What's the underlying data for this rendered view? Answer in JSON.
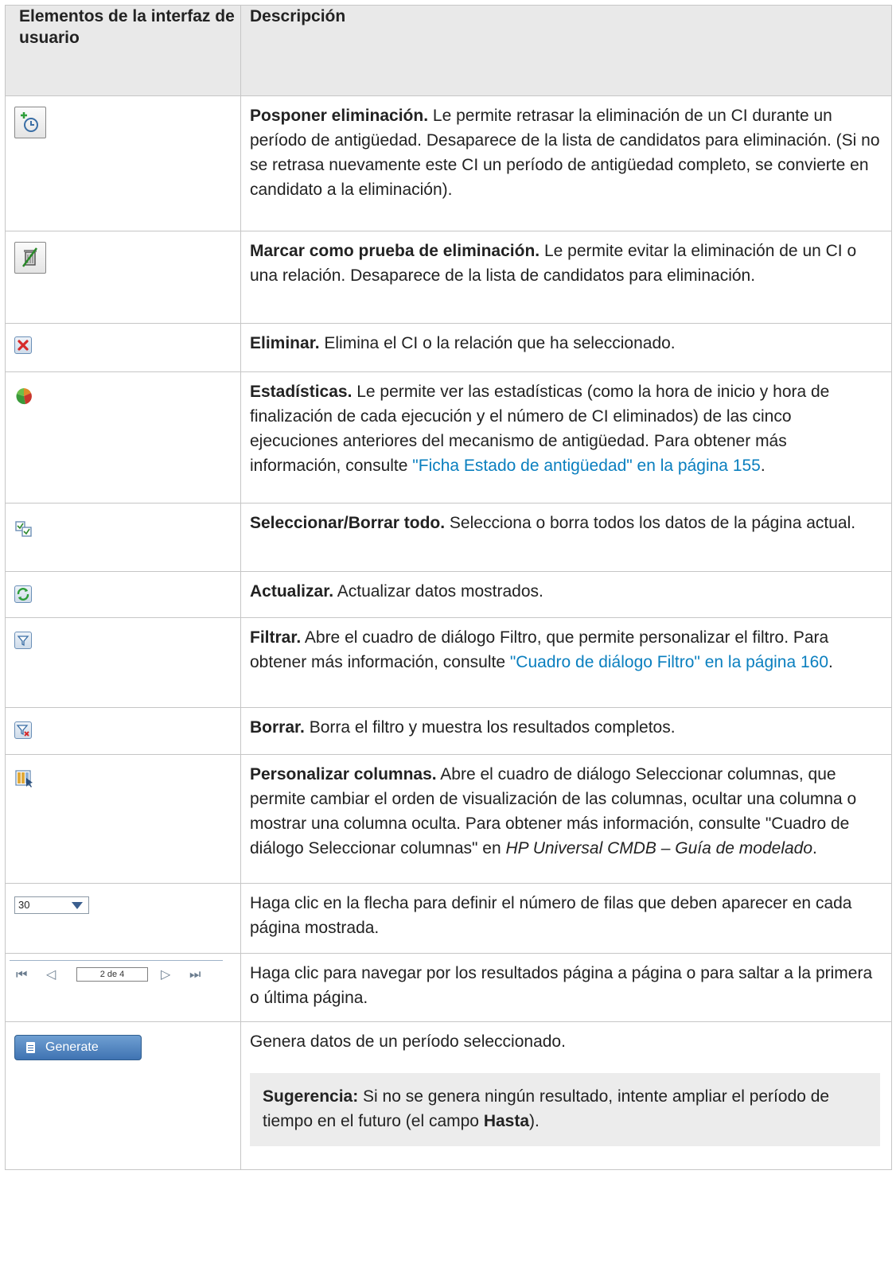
{
  "header": {
    "col1": "Elementos de la interfaz de usuario",
    "col2": "Descripción"
  },
  "rows": [
    {
      "icon": "postpone-deletion-icon",
      "title": "Posponer eliminación.",
      "text": " Le permite retrasar la eliminación de un CI durante un período de antigüedad. Desaparece de la lista de candidatos para eliminación. (Si no se retrasa nuevamente este CI un período de antigüedad completo, se convierte en candidato a la eliminación)."
    },
    {
      "icon": "deletion-proof-icon",
      "title": "Marcar como prueba de eliminación.",
      "text": " Le permite evitar la eliminación de un CI o una relación. Desaparece de la lista de candidatos para eliminación."
    },
    {
      "icon": "delete-icon",
      "title": "Eliminar.",
      "text": " Elimina el CI o la relación que ha seleccionado."
    },
    {
      "icon": "statistics-pie-icon",
      "title": "Estadísticas.",
      "text": " Le permite ver las estadísticas (como la hora de inicio y hora de finalización de cada ejecución y el número de CI eliminados) de las cinco ejecuciones anteriores del mecanismo de antigüedad. Para obtener más información, consulte ",
      "link": "\"Ficha Estado de antigüedad\" en la página 155",
      "after": "."
    },
    {
      "icon": "select-clear-all-icon",
      "title": "Seleccionar/Borrar todo.",
      "text": " Selecciona o borra todos los datos de la página actual."
    },
    {
      "icon": "refresh-icon",
      "title": "Actualizar.",
      "text": " Actualizar datos mostrados."
    },
    {
      "icon": "filter-icon",
      "title": "Filtrar.",
      "text": " Abre el cuadro de diálogo Filtro, que permite personalizar el filtro. Para obtener más información, consulte ",
      "link": "\"Cuadro de diálogo Filtro\" en la página 160",
      "after": "."
    },
    {
      "icon": "clear-filter-icon",
      "title": "Borrar.",
      "text": " Borra el filtro y muestra los resultados completos."
    },
    {
      "icon": "customize-columns-icon",
      "title": "Personalizar columnas.",
      "text": " Abre el cuadro de diálogo Seleccionar columnas, que permite cambiar el orden de visualización de las columnas, ocultar una columna o mostrar una columna oculta. Para obtener más información, consulte \"Cuadro de diálogo Seleccionar columnas\" en ",
      "italic": "HP Universal CMDB – Guía de modelado",
      "after": "."
    },
    {
      "control": "rows-per-page-select",
      "value": "30",
      "text": "Haga clic en la flecha para definir el número de filas que deben aparecer en cada página mostrada."
    },
    {
      "control": "pager",
      "value": "2 de 4",
      "text": "Haga clic para navegar por los resultados página a página o para saltar a la primera o última página."
    },
    {
      "control": "generate-button",
      "value": "Generate",
      "text": "Genera datos de un período seleccionado.",
      "tip_label": "Sugerencia:",
      "tip_text": " Si no se genera ningún resultado, intente ampliar el período de tiempo en el futuro (el campo ",
      "tip_bold": "Hasta",
      "tip_after": ")."
    }
  ]
}
